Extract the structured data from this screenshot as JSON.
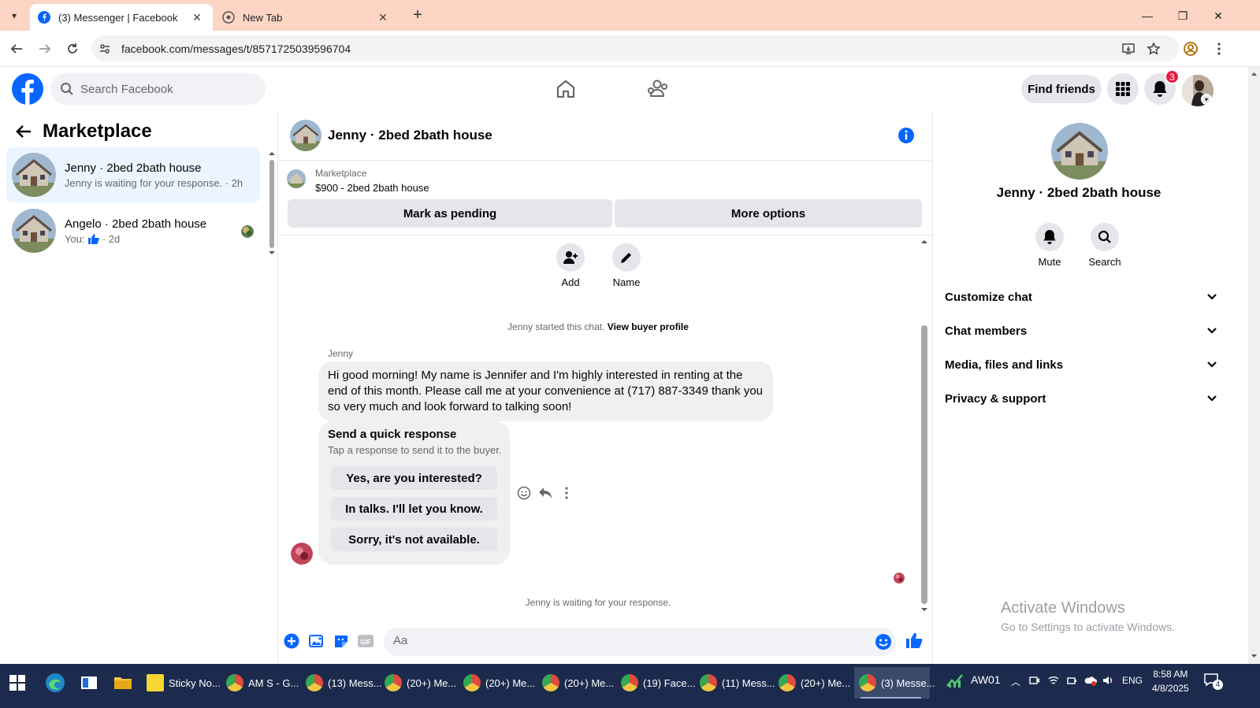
{
  "browser": {
    "tabs": [
      {
        "title": "(3) Messenger | Facebook",
        "active": true
      },
      {
        "title": "New Tab",
        "active": false
      }
    ],
    "url": "facebook.com/messages/t/8571725039596704"
  },
  "fb_header": {
    "search_placeholder": "Search Facebook",
    "find_friends": "Find friends",
    "notification_count": "3"
  },
  "left_panel": {
    "title": "Marketplace",
    "conversations": [
      {
        "name": "Jenny · 2bed 2bath house",
        "preview": "Jenny is waiting for your response. · 2h",
        "active": true
      },
      {
        "name": "Angelo · 2bed 2bath house",
        "preview_prefix": "You:",
        "preview_suffix": "· 2d",
        "active": false
      }
    ]
  },
  "chat": {
    "title": "Jenny · 2bed 2bath house",
    "marketplace_label": "Marketplace",
    "listing": "$900 - 2bed 2bath house",
    "mark_pending": "Mark as pending",
    "more_options": "More options",
    "actions": [
      {
        "label": "Add",
        "icon": "add-person-icon"
      },
      {
        "label": "Name",
        "icon": "pencil-icon"
      }
    ],
    "started_text": "Jenny started this chat.",
    "view_profile": "View buyer profile",
    "sender": "Jenny",
    "message": "Hi good morning! My name is Jennifer and I'm highly interested in renting at the end of this month. Please call me at your convenience at (717) 887-3349 thank you so very much and look forward to talking soon!",
    "quick_title": "Send a quick response",
    "quick_sub": "Tap a response to send it to the buyer.",
    "quick_replies": [
      "Yes, are you interested?",
      "In talks. I'll let you know.",
      "Sorry, it's not available."
    ],
    "waiting_text": "Jenny is waiting for your response.",
    "composer_placeholder": "Aa",
    "gif_label": "GIF"
  },
  "right_panel": {
    "name": "Jenny · 2bed 2bath house",
    "actions": [
      {
        "label": "Mute",
        "icon": "bell-icon"
      },
      {
        "label": "Search",
        "icon": "search-icon"
      }
    ],
    "sections": [
      "Customize chat",
      "Chat members",
      "Media, files and links",
      "Privacy & support"
    ]
  },
  "watermark": {
    "line1": "Activate Windows",
    "line2": "Go to Settings to activate Windows."
  },
  "taskbar": {
    "apps": [
      {
        "label": "Sticky No...",
        "color": "#f7d631"
      },
      {
        "label": "AM S - G...",
        "color": "#de4c3c"
      },
      {
        "label": "(13) Mess...",
        "color": "#de4c3c"
      },
      {
        "label": "(20+) Me...",
        "color": "#de4c3c"
      },
      {
        "label": "(20+) Me...",
        "color": "#de4c3c"
      },
      {
        "label": "(20+) Me...",
        "color": "#de4c3c"
      },
      {
        "label": "(19) Face...",
        "color": "#de4c3c"
      },
      {
        "label": "(11) Mess...",
        "color": "#de4c3c"
      },
      {
        "label": "(20+) Me...",
        "color": "#de4c3c"
      },
      {
        "label": "(3) Messe...",
        "color": "#de4c3c"
      }
    ],
    "stock": "AW01",
    "lang": "ENG",
    "time": "8:58 AM",
    "date": "4/8/2025",
    "notif_count": "4"
  },
  "colors": {
    "fb_blue": "#0866ff",
    "tab_bar": "#fcd5c4",
    "taskbar": "#1c2b4d",
    "active_convo": "#ebf5ff"
  }
}
